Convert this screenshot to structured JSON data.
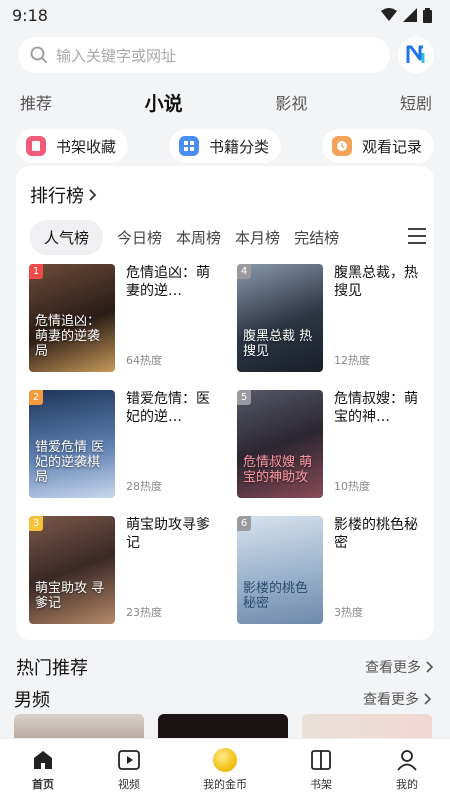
{
  "status": {
    "time": "9:18"
  },
  "search": {
    "placeholder": "输入关键字或网址"
  },
  "main_tabs": [
    {
      "label": "推荐"
    },
    {
      "label": "小说"
    },
    {
      "label": "影视"
    },
    {
      "label": "短剧"
    }
  ],
  "quick_links": [
    {
      "label": "书架收藏",
      "color": "#f25b7a"
    },
    {
      "label": "书籍分类",
      "color": "#4a8df0"
    },
    {
      "label": "观看记录",
      "color": "#f5a35b"
    }
  ],
  "ranking": {
    "title": "排行榜",
    "tabs": [
      {
        "label": "人气榜"
      },
      {
        "label": "今日榜"
      },
      {
        "label": "本周榜"
      },
      {
        "label": "本月榜"
      },
      {
        "label": "完结榜"
      }
    ],
    "books": [
      {
        "rank": "1",
        "title": "危情追凶：萌妻的逆…",
        "heat": "64热度",
        "cover_text": "危情追凶：萌妻的逆袭局",
        "rank_color": "#f24a4a",
        "cover_color": "#3b2a22"
      },
      {
        "rank": "4",
        "title": "腹黑总裁，热搜见",
        "heat": "12热度",
        "cover_text": "腹黑总裁 热搜见",
        "rank_color": "#9a9aa0",
        "cover_color": "#2f3a4a"
      },
      {
        "rank": "2",
        "title": "错爱危情：医妃的逆…",
        "heat": "28热度",
        "cover_text": "错爱危情 医妃的逆袭棋局",
        "rank_color": "#f59a3a",
        "cover_color": "#3d5478"
      },
      {
        "rank": "5",
        "title": "危情叔嫂：萌宝的神…",
        "heat": "10热度",
        "cover_text": "危情叔嫂 萌宝的神助攻",
        "rank_color": "#9a9aa0",
        "cover_color": "#3a3340"
      },
      {
        "rank": "3",
        "title": "萌宝助攻寻爹记",
        "heat": "23热度",
        "cover_text": "萌宝助攻 寻爹记",
        "rank_color": "#f5c23a",
        "cover_color": "#5a3e36"
      },
      {
        "rank": "6",
        "title": "影楼的桃色秘密",
        "heat": "3热度",
        "cover_text": "影楼的桃色秘密",
        "rank_color": "#9a9aa0",
        "cover_color": "#9bb3cc"
      }
    ]
  },
  "hot": {
    "title": "热门推荐",
    "more": "查看更多"
  },
  "male": {
    "title": "男频",
    "more": "查看更多"
  },
  "bottom_nav": [
    {
      "label": "首页"
    },
    {
      "label": "视频"
    },
    {
      "label": "我的金币"
    },
    {
      "label": "书架"
    },
    {
      "label": "我的"
    }
  ]
}
